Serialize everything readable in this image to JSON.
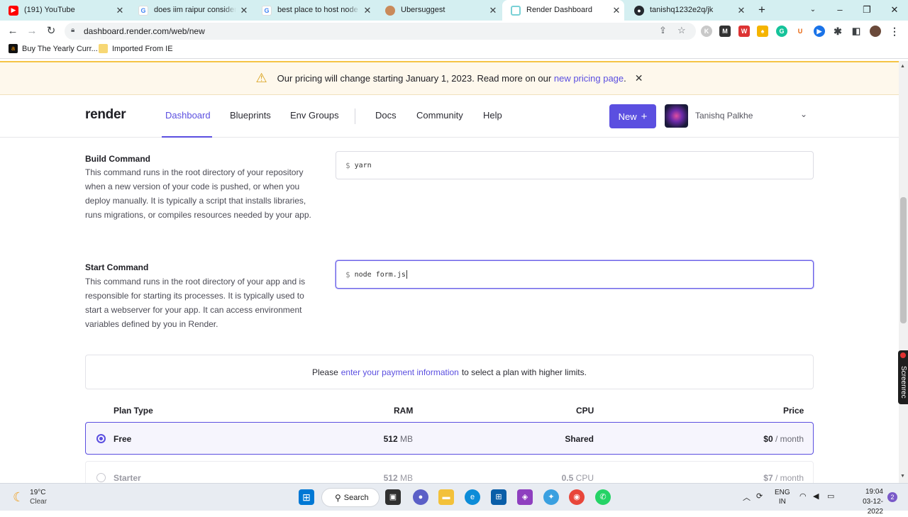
{
  "browser": {
    "tabs": [
      {
        "title": "(191) YouTube",
        "favicon": "youtube-icon",
        "color": "#ff0000",
        "active": false
      },
      {
        "title": "does iim raipur consider gr",
        "favicon": "google-icon",
        "color": "#4285f4",
        "active": false
      },
      {
        "title": "best place to host node js a",
        "favicon": "google-icon",
        "color": "#4285f4",
        "active": false
      },
      {
        "title": "Ubersuggest",
        "favicon": "ubersuggest-icon",
        "color": "#c98a5a",
        "active": false
      },
      {
        "title": "Render Dashboard",
        "favicon": "render-icon",
        "color": "#7ad1d6",
        "active": true
      },
      {
        "title": "tanishq1232e2q/jk",
        "favicon": "github-icon",
        "color": "#24292f",
        "active": false
      }
    ],
    "new_tab_symbol": "+",
    "url": "dashboard.render.com/web/new",
    "bookmarks": [
      {
        "label": "Buy The Yearly Curr...",
        "icon": "amazon-icon"
      },
      {
        "label": "Imported From IE",
        "icon": "folder-icon"
      }
    ]
  },
  "banner": {
    "text_before": "Our pricing will change starting January 1, 2023. Read more on our",
    "link": "new pricing page",
    "text_after": "."
  },
  "nav": {
    "logo": "render",
    "items": [
      "Dashboard",
      "Blueprints",
      "Env Groups"
    ],
    "items2": [
      "Docs",
      "Community",
      "Help"
    ],
    "new_button": "New",
    "user_name": "Tanishq Palkhe"
  },
  "build": {
    "title": "Build Command",
    "description": "This command runs in the root directory of your repository when a new version of your code is pushed, or when you deploy manually. It is typically a script that installs libraries, runs migrations, or compiles resources needed by your app.",
    "prompt": "$",
    "value": "yarn"
  },
  "start": {
    "title": "Start Command",
    "description": "This command runs in the root directory of your app and is responsible for starting its processes. It is typically used to start a webserver for your app. It can access environment variables defined by you in Render.",
    "prompt": "$",
    "value": "node form.js"
  },
  "payment": {
    "text_before": "Please",
    "link": "enter your payment information",
    "text_after": "to select a plan with higher limits."
  },
  "plans": {
    "headers": [
      "Plan Type",
      "RAM",
      "CPU",
      "Price"
    ],
    "rows": [
      {
        "name": "Free",
        "ram": "512",
        "ram_unit": "MB",
        "cpu": "Shared",
        "cpu_unit": "",
        "price": "$0",
        "price_unit": "/ month",
        "selected": true
      },
      {
        "name": "Starter",
        "ram": "512",
        "ram_unit": "MB",
        "cpu": "0.5",
        "cpu_unit": "CPU",
        "price": "$7",
        "price_unit": "/ month",
        "selected": false
      }
    ]
  },
  "side_widget": "Screenrec",
  "taskbar": {
    "weather_temp": "19°C",
    "weather_desc": "Clear",
    "search_label": "Search",
    "language": "ENG",
    "region": "IN",
    "time": "19:04",
    "date": "03-12-2022",
    "notification_count": "2"
  }
}
